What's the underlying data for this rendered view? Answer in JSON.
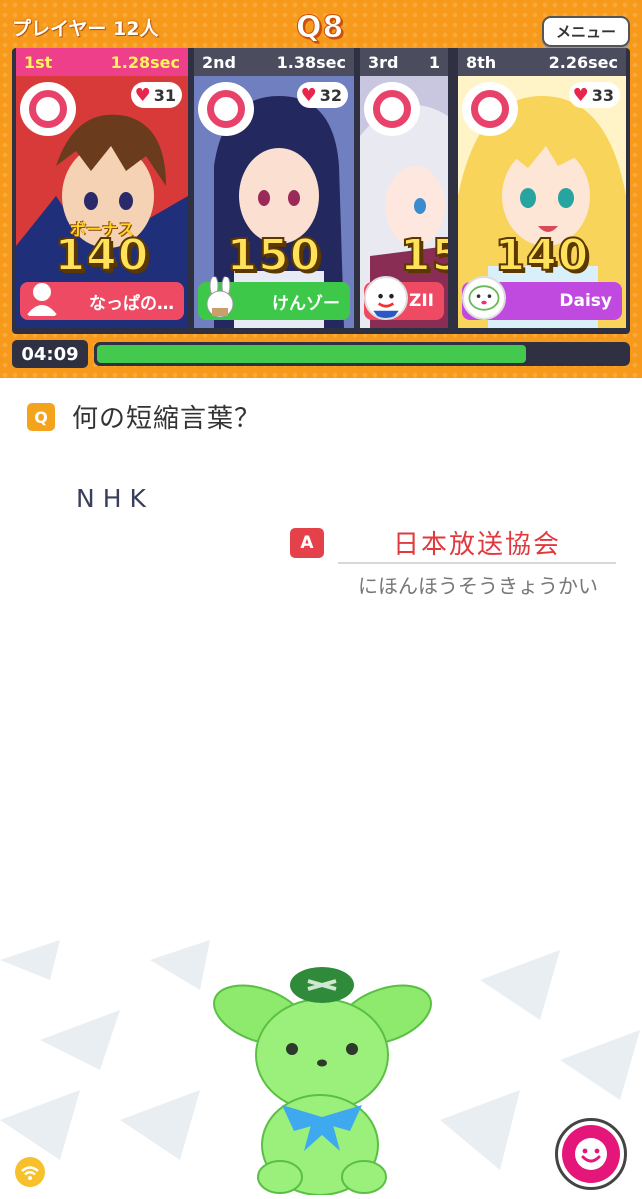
{
  "header": {
    "players_label": "プレイヤー 12人",
    "question_number": "Q8",
    "menu_label": "メニュー"
  },
  "cards": [
    {
      "rank": "1st",
      "time": "1.28sec",
      "hearts": "31",
      "bonus": "ボーナス",
      "score": "140",
      "name": "なっぱの…",
      "name_color": "#ee4a63"
    },
    {
      "rank": "2nd",
      "time": "1.38sec",
      "hearts": "32",
      "bonus": "",
      "score": "150",
      "name": "けんゾー",
      "name_color": "#3ec84a"
    },
    {
      "rank": "3rd",
      "time": "1",
      "hearts": "",
      "bonus": "",
      "score": "15",
      "name": "ZII",
      "name_color": "#ee4a63"
    },
    {
      "rank": "8th",
      "time": "2.26sec",
      "hearts": "33",
      "bonus": "",
      "score": "140",
      "name": "Daisy",
      "name_color": "#c04adf"
    }
  ],
  "timer": {
    "label": "04:09",
    "remaining_fraction": 0.81
  },
  "question": {
    "badge": "Q",
    "text": "何の短縮言葉？",
    "prompt": "NHK"
  },
  "answer": {
    "badge": "A",
    "text": "日本放送協会",
    "reading": "にほんほうそうきょうかい"
  },
  "colors": {
    "header_orange": "#f79a1b",
    "panel_dark": "#2f3142",
    "timer_green": "#43c94d",
    "answer_red": "#e03a3f",
    "accent_pink": "#e4167a"
  },
  "icons": {
    "wifi": "wifi-icon",
    "smile": "smile-icon",
    "correct_mark": "circle-correct-icon",
    "heart": "heart-icon"
  }
}
